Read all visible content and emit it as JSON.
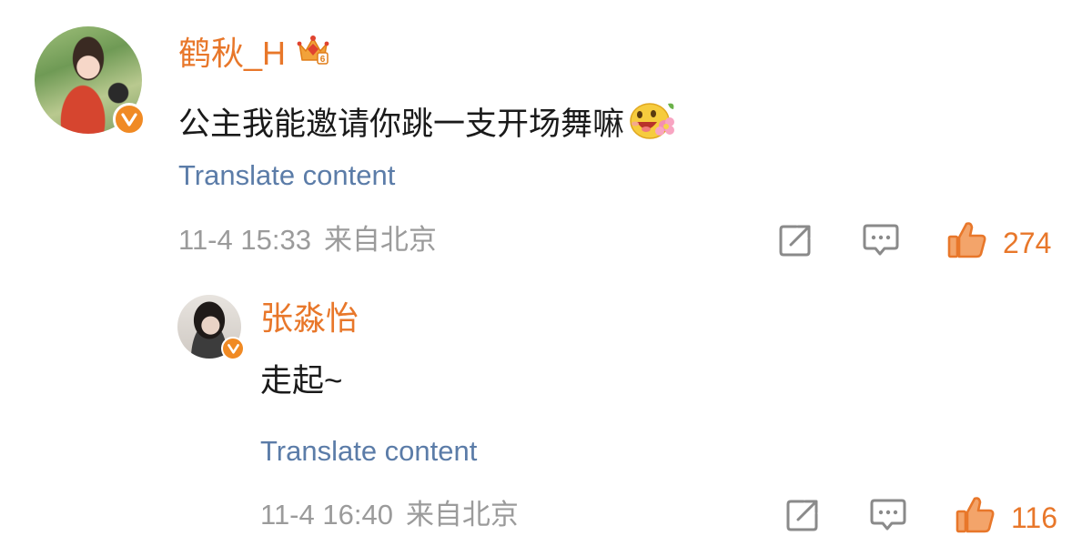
{
  "comment": {
    "username": "鹤秋_H",
    "text": "公主我能邀请你跳一支开场舞嘛",
    "translate_label": "Translate content",
    "time": "11-4 15:33",
    "location": "来自北京",
    "likes": "274",
    "icons": {
      "avatar_badge": "verified-v-icon",
      "level": "crown-level-6-icon",
      "emoji": "blush-flower-emoji-icon",
      "share": "share-arrow-icon",
      "reply": "comment-bubble-icon",
      "like": "thumbs-up-icon"
    }
  },
  "reply": {
    "username": "张淼怡",
    "text": "走起~",
    "translate_label": "Translate content",
    "time": "11-4 16:40",
    "location": "来自北京",
    "likes": "116",
    "icons": {
      "avatar_badge": "verified-v-icon",
      "share": "share-arrow-icon",
      "reply": "comment-bubble-icon",
      "like": "thumbs-up-icon"
    }
  },
  "colors": {
    "accent": "#e8772a",
    "link": "#5b7ca8",
    "meta": "#9b9b9b",
    "text": "#1a1a1a",
    "icon_gray": "#8a8a8a"
  }
}
